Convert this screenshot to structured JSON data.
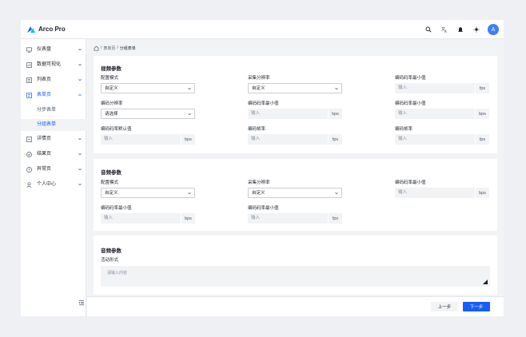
{
  "app": {
    "brand": "Arco Pro",
    "avatar_letter": "A",
    "nav_icons": [
      "search-icon",
      "translate-icon",
      "bell-icon",
      "sun-icon"
    ],
    "accent_color": "#165dff"
  },
  "sidebar": {
    "items": [
      {
        "label": "仪表盘",
        "icon": "dashboard-icon"
      },
      {
        "label": "数据可视化",
        "icon": "chart-icon"
      },
      {
        "label": "列表页",
        "icon": "list-icon"
      },
      {
        "label": "表单页",
        "icon": "form-icon",
        "active": true
      },
      {
        "label": "详情页",
        "icon": "detail-icon"
      },
      {
        "label": "结果页",
        "icon": "result-icon"
      },
      {
        "label": "异常页",
        "icon": "exception-icon"
      },
      {
        "label": "个人中心",
        "icon": "user-icon"
      }
    ],
    "sub_items": [
      {
        "label": "分步表单"
      },
      {
        "label": "分组表单",
        "selected": true
      }
    ]
  },
  "breadcrumb": {
    "home_icon": "home-icon",
    "items": [
      "表单页",
      "分组表单"
    ],
    "separator": "/"
  },
  "video": {
    "title": "视频参数",
    "fields": [
      {
        "label": "配置模式",
        "value": "自定义",
        "type": "select"
      },
      {
        "label": "采集分辨率",
        "value": "自定义",
        "type": "select"
      },
      {
        "label": "编码码率最小值",
        "placeholder": "输入",
        "unit": "fps",
        "type": "input"
      },
      {
        "label": "编码分辨率",
        "placeholder": "请选择",
        "type": "select"
      },
      {
        "label": "编码码率最小值",
        "placeholder": "输入",
        "unit": "bps",
        "type": "input"
      },
      {
        "label": "编码码率最小值",
        "placeholder": "输入",
        "unit": "bps",
        "type": "input"
      },
      {
        "label": "编码码率默认值",
        "placeholder": "输入",
        "unit": "bps",
        "type": "input"
      },
      {
        "label": "编码帧率",
        "placeholder": "输入",
        "unit": "fps",
        "type": "input"
      },
      {
        "label": "编码帧率",
        "placeholder": "输入",
        "unit": "fps",
        "type": "input"
      }
    ]
  },
  "audio": {
    "title": "音频参数",
    "fields": [
      {
        "label": "配置模式",
        "value": "自定义",
        "type": "select"
      },
      {
        "label": "采集分辨率",
        "value": "自定义",
        "type": "select"
      },
      {
        "label": "编码码率最小值",
        "placeholder": "输入",
        "unit": "bps",
        "type": "input"
      },
      {
        "label": "编码码率最小值",
        "placeholder": "输入",
        "unit": "bps",
        "type": "input"
      },
      {
        "label": "编码码率最小值",
        "placeholder": "输入",
        "unit": "fps",
        "type": "input"
      }
    ]
  },
  "description": {
    "title": "音频参数",
    "label": "活动形式",
    "placeholder": "请输入内容"
  },
  "footer": {
    "prev_label": "上一步",
    "next_label": "下一步"
  }
}
